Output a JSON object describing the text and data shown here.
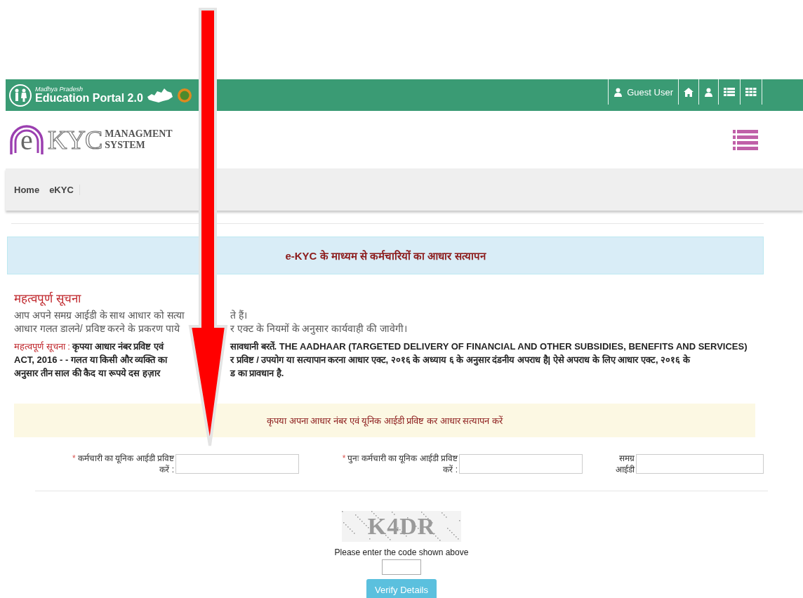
{
  "top_bar": {
    "portal_state": "Madhya Pradesh",
    "portal_name": "Education Portal 2.0",
    "user_name": "Guest User"
  },
  "brand": {
    "logo_letter": "e",
    "logo_text": "KYC",
    "subtitle_lines": [
      "MANAGMENT",
      "SYSTEM"
    ]
  },
  "breadcrumb": [
    {
      "label": "Home"
    },
    {
      "label": "eKYC"
    }
  ],
  "title_banner": "e-KYC के माध्यम से कर्मचारियों का आधार सत्यापन",
  "notice": {
    "heading": "महत्वपूर्ण सूचना",
    "lines": [
      {
        "left": "आप अपने समग्र आईडी के साथ आधार को सत्या",
        "right": "ते हैं।"
      },
      {
        "left": "आधार गलत डालने/ प्रविष्ट करने के प्रकरण पाये",
        "right": "र एक्ट के नियमों के अनुसार कार्यवाही की जावेगी।"
      }
    ],
    "paragraph": [
      {
        "lead": "महत्वपूर्ण सूचना :",
        "left": "कृपया आधार नंबर प्रविष्ट एवं",
        "right": "सावधानी बरतें. THE AADHAAR (TARGETED DELIVERY OF FINANCIAL AND OTHER SUBSIDIES, BENEFITS AND SERVICES)"
      },
      {
        "left": "ACT, 2016 - - गलत या किसी और व्यक्ति का",
        "right": "र प्रविष्ट / उपयोग या सत्यापान करना आधार एक्ट, २०१६ के अध्याय ६ के अनुसार दंडनीय अपराध है| ऐसे अपराध के लिए आधार एक्ट, २०१६ के"
      },
      {
        "left": "अनुसार तीन साल की कैद या रूपये दस हज़ार",
        "right": "ड का प्रावधान है."
      }
    ]
  },
  "instruction_banner": "कृपया अपना आधार नंबर एवं यूनिक आईडी प्रविष्ट कर आधार सत्यापन करें",
  "fields": [
    {
      "marker": "*",
      "label": "कर्मचारी का यूनिक आईडी प्रविष्ट\nकरें :"
    },
    {
      "marker": "*",
      "label": "पुनः कर्मचारी का यूनिक आईडी प्रविष्ट\nकरें :"
    },
    {
      "label": "समग्र\nआईडी"
    }
  ],
  "captcha": {
    "code": "K4DR",
    "prompt": "Please enter the code shown above"
  },
  "submit_button": "Verify Details"
}
